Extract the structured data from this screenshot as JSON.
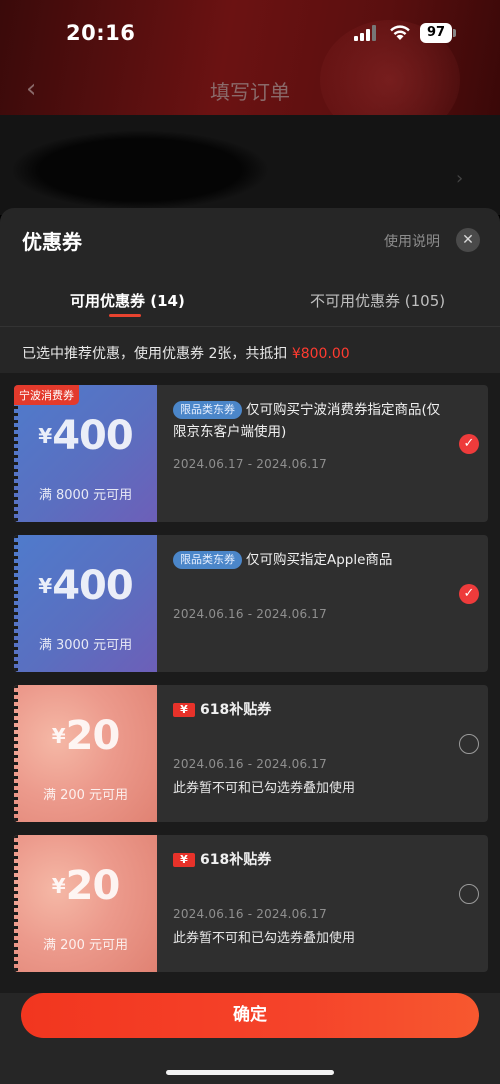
{
  "status_bar": {
    "time": "20:16",
    "battery": "97"
  },
  "nav": {
    "back_icon": "chevron-left-icon",
    "title": "填写订单"
  },
  "sheet": {
    "title": "优惠券",
    "help_link": "使用说明",
    "close_icon": "close-icon"
  },
  "tabs": [
    {
      "label": "可用优惠券 (14)",
      "active": true
    },
    {
      "label": "不可用优惠券 (105)",
      "active": false
    }
  ],
  "summary": {
    "text": "已选中推荐优惠，使用优惠券 2张，共抵扣 ",
    "amount": "¥800.00"
  },
  "coupons": [
    {
      "corner_tag": "宁波消费券",
      "currency": "¥",
      "amount": "400",
      "threshold": "满 8000 元可用",
      "chip": "限品类东券",
      "title": "仅可购买宁波消费券指定商品(仅限京东客户端使用)",
      "date": "2024.06.17 - 2024.06.17",
      "note": "",
      "selected": true
    },
    {
      "corner_tag": "",
      "currency": "¥",
      "amount": "400",
      "threshold": "满 3000 元可用",
      "chip": "限品类东券",
      "title": "仅可购买指定Apple商品",
      "date": "2024.06.16 - 2024.06.17",
      "note": "",
      "selected": true
    },
    {
      "corner_tag": "",
      "currency": "¥",
      "amount": "20",
      "threshold": "满 200 元可用",
      "chip": "¥",
      "title": "618补贴券",
      "date": "2024.06.16 - 2024.06.17",
      "note": "此券暂不可和已勾选券叠加使用",
      "selected": false
    },
    {
      "corner_tag": "",
      "currency": "¥",
      "amount": "20",
      "threshold": "满 200 元可用",
      "chip": "¥",
      "title": "618补贴券",
      "date": "2024.06.16 - 2024.06.17",
      "note": "此券暂不可和已勾选券叠加使用",
      "selected": false
    }
  ],
  "confirm_button": "确定",
  "colors": {
    "accent_red": "#ee3b3b",
    "chip_blue": "#4b86c9"
  }
}
